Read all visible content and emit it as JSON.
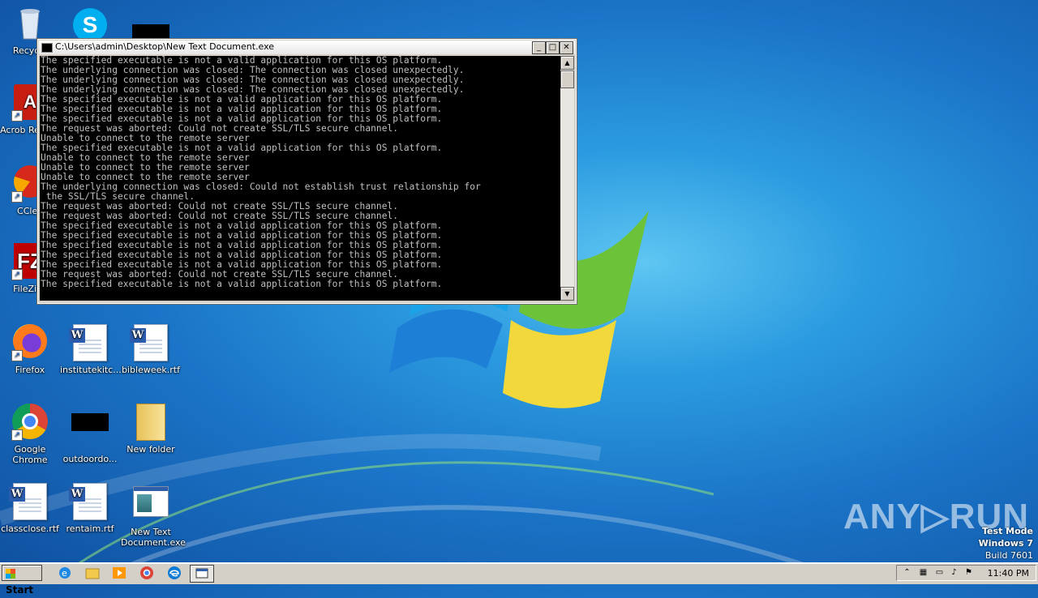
{
  "console": {
    "title": "C:\\Users\\admin\\Desktop\\New Text Document.exe",
    "lines": [
      "The specified executable is not a valid application for this OS platform.",
      "The underlying connection was closed: The connection was closed unexpectedly.",
      "The underlying connection was closed: The connection was closed unexpectedly.",
      "The underlying connection was closed: The connection was closed unexpectedly.",
      "The specified executable is not a valid application for this OS platform.",
      "The specified executable is not a valid application for this OS platform.",
      "The specified executable is not a valid application for this OS platform.",
      "The request was aborted: Could not create SSL/TLS secure channel.",
      "Unable to connect to the remote server",
      "The specified executable is not a valid application for this OS platform.",
      "Unable to connect to the remote server",
      "Unable to connect to the remote server",
      "Unable to connect to the remote server",
      "The underlying connection was closed: Could not establish trust relationship for",
      " the SSL/TLS secure channel.",
      "The request was aborted: Could not create SSL/TLS secure channel.",
      "The request was aborted: Could not create SSL/TLS secure channel.",
      "The specified executable is not a valid application for this OS platform.",
      "The specified executable is not a valid application for this OS platform.",
      "The specified executable is not a valid application for this OS platform.",
      "The specified executable is not a valid application for this OS platform.",
      "The specified executable is not a valid application for this OS platform.",
      "The request was aborted: Could not create SSL/TLS secure channel.",
      "The specified executable is not a valid application for this OS platform."
    ],
    "buttons": {
      "minimize": "_",
      "maximize": "□",
      "close": "✕"
    }
  },
  "desktop_icons": [
    {
      "label": "Recycle",
      "icon": "recycle-bin-icon"
    },
    {
      "label": "Acrob Reader",
      "icon": "acrobat-reader-icon"
    },
    {
      "label": "CClea",
      "icon": "ccleaner-icon"
    },
    {
      "label": "FileZilla",
      "icon": "filezilla-icon"
    },
    {
      "label": "Firefox",
      "icon": "firefox-icon"
    },
    {
      "label": "institutekitc...",
      "icon": "word-document-icon"
    },
    {
      "label": "bibleweek.rtf",
      "icon": "word-document-icon"
    },
    {
      "label": "Google Chrome",
      "icon": "chrome-icon"
    },
    {
      "label": "outdoordo...",
      "icon": "black-thumbnail-icon"
    },
    {
      "label": "New folder",
      "icon": "folder-icon"
    },
    {
      "label": "classclose.rtf",
      "icon": "word-document-icon"
    },
    {
      "label": "rentaim.rtf",
      "icon": "word-document-icon"
    },
    {
      "label": "New Text Document.exe",
      "icon": "exe-icon"
    }
  ],
  "taskbar": {
    "start_label": "Start",
    "clock": "11:40 PM",
    "pinned": [
      "ie-icon",
      "explorer-icon",
      "media-player-icon",
      "chrome-icon",
      "edge-icon",
      "console-window-icon"
    ]
  },
  "watermark": {
    "brand": "ANY▷RUN",
    "test_mode": "Test Mode",
    "os": "Windows 7",
    "build": "Build 7601"
  }
}
